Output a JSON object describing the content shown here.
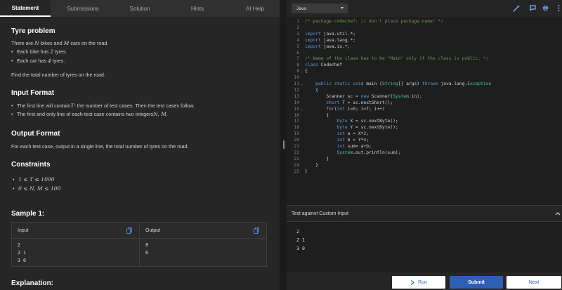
{
  "tabs": [
    "Statement",
    "Submissions",
    "Solution",
    "Hints",
    "AI Help"
  ],
  "problem": {
    "title": "Tyre problem",
    "intro_pre": "There are ",
    "intro_n": "N",
    "intro_mid": " bikes and ",
    "intro_m": "M",
    "intro_post": " cars on the road.",
    "bullets": [
      {
        "pre": "Each bike has ",
        "math": "2",
        "post": " tyres."
      },
      {
        "pre": "Each car has ",
        "math": "4",
        "post": " tyres."
      }
    ],
    "task": "Find the total number of tyres on the road."
  },
  "input_format": {
    "title": "Input Format",
    "b1_pre": "The first line will contain ",
    "b1_math": "T",
    "b1_post": " - the number of test cases. Then the test cases follow.",
    "b2_pre": "The first and only line of each test case contains two integers ",
    "b2_math": "N, M",
    "b2_post": "."
  },
  "output_format": {
    "title": "Output Format",
    "text": "For each test case, output in a single line, the total number of tyres on the road."
  },
  "constraints": {
    "title": "Constraints",
    "items": [
      "1 ≤ T ≤ 1000",
      "0 ≤ N, M ≤ 100"
    ]
  },
  "sample": {
    "title": "Sample 1:",
    "input_label": "Input",
    "output_label": "Output",
    "input": "2\n2 1\n3 0",
    "output": "8\n6"
  },
  "explanation_title": "Explanation:",
  "editor": {
    "language": "Java",
    "lines": [
      [
        [
          "c-com",
          "/* package codechef; // don't place package name! */"
        ]
      ],
      [],
      [
        [
          "c-kw",
          "import"
        ],
        [
          "",
          " java.util.*;"
        ]
      ],
      [
        [
          "c-kw",
          "import"
        ],
        [
          "",
          " java.lang.*;"
        ]
      ],
      [
        [
          "c-kw",
          "import"
        ],
        [
          "",
          " java.io.*;"
        ]
      ],
      [],
      [
        [
          "c-com",
          "/* Name of the class has to be \"Main\" only if the class is public. */"
        ]
      ],
      [
        [
          "c-kw",
          "class"
        ],
        [
          "",
          " Codechef"
        ]
      ],
      [
        [
          "",
          "{"
        ]
      ],
      [],
      [
        [
          "",
          "    "
        ],
        [
          "c-kw",
          "public static void"
        ],
        [
          "",
          " main ("
        ],
        [
          "c-ty",
          "String"
        ],
        [
          "",
          "[] args) "
        ],
        [
          "c-kw",
          "throws"
        ],
        [
          "",
          " java.lang."
        ],
        [
          "c-ty",
          "Exception"
        ]
      ],
      [
        [
          "",
          "    {"
        ]
      ],
      [
        [
          "",
          "        Scanner sc = "
        ],
        [
          "c-kw",
          "new"
        ],
        [
          "",
          " Scanner("
        ],
        [
          "c-ty",
          "System"
        ],
        [
          "",
          ".in);"
        ]
      ],
      [
        [
          "",
          "        "
        ],
        [
          "c-kw",
          "short"
        ],
        [
          "",
          " T = sc.nextShort();"
        ]
      ],
      [
        [
          "",
          "        "
        ],
        [
          "c-kw2",
          "for"
        ],
        [
          "",
          "("
        ],
        [
          "c-kw",
          "int"
        ],
        [
          "",
          " i="
        ],
        [
          "c-num",
          "0"
        ],
        [
          "",
          "; i<T; i++)"
        ]
      ],
      [
        [
          "",
          "        {"
        ]
      ],
      [
        [
          "",
          "            "
        ],
        [
          "c-kw",
          "byte"
        ],
        [
          "",
          " X = sc.nextByte();"
        ]
      ],
      [
        [
          "",
          "            "
        ],
        [
          "c-kw",
          "byte"
        ],
        [
          "",
          " Y = sc.nextByte();"
        ]
      ],
      [
        [
          "",
          "            "
        ],
        [
          "c-kw",
          "int"
        ],
        [
          "",
          " a = X*"
        ],
        [
          "c-num",
          "2"
        ],
        [
          "",
          ";"
        ]
      ],
      [
        [
          "",
          "            "
        ],
        [
          "c-kw",
          "int"
        ],
        [
          "",
          " b = Y*"
        ],
        [
          "c-num",
          "4"
        ],
        [
          "",
          ";"
        ]
      ],
      [
        [
          "",
          "            "
        ],
        [
          "c-kw",
          "int"
        ],
        [
          "",
          " sum= a+b;"
        ]
      ],
      [
        [
          "",
          "            "
        ],
        [
          "c-ty",
          "System"
        ],
        [
          "",
          ".out.println(sum);"
        ]
      ],
      [
        [
          "",
          "        }"
        ]
      ],
      [
        [
          "",
          "    }"
        ]
      ],
      [
        [
          "",
          "}"
        ]
      ]
    ],
    "fold_lines": [
      9,
      11,
      15
    ]
  },
  "custom_input": {
    "label": "Test against Custom Input",
    "value": "2\n2 1\n3 0"
  },
  "buttons": {
    "run": "Run",
    "submit": "Submit",
    "next": "Next"
  },
  "colors": {
    "accent": "#2f5fb3",
    "editor_bg": "#1e1e1e",
    "panel_bg": "#262626"
  }
}
